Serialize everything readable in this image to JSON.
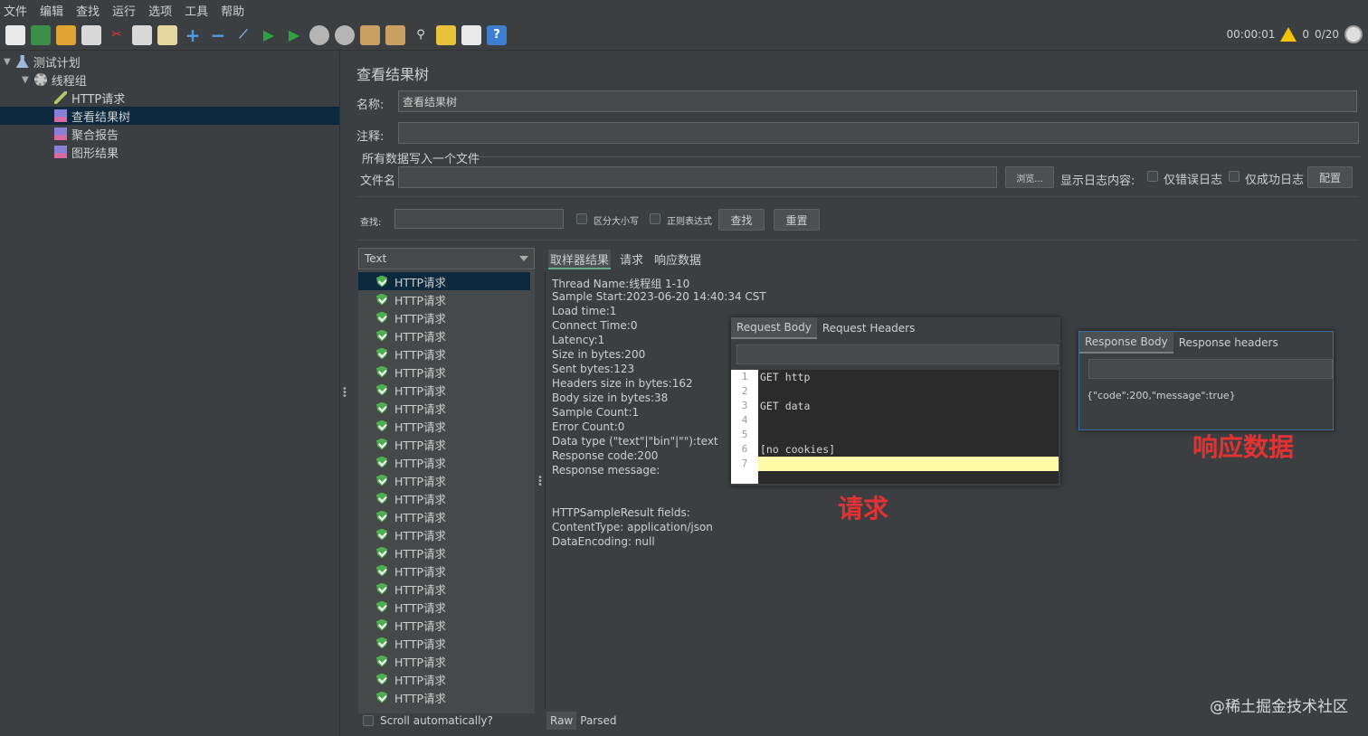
{
  "menu": [
    "文件",
    "编辑",
    "查找",
    "运行",
    "选项",
    "工具",
    "帮助"
  ],
  "toolbar": {
    "timer": "00:00:01",
    "warn_count": "0",
    "threads": "0/20",
    "icons": [
      "new-file-icon",
      "templates-icon",
      "open-icon",
      "save-icon",
      "cut-icon",
      "copy-icon",
      "paste-icon",
      "expand-icon",
      "collapse-icon",
      "toggle-icon",
      "start-icon",
      "start-no-pause-icon",
      "stop-icon",
      "shutdown-icon",
      "clear-icon",
      "clear-all-icon",
      "search-icon",
      "reset-search-icon",
      "function-helper-icon",
      "help-icon"
    ]
  },
  "tree": {
    "items": [
      {
        "label": "测试计划",
        "icon": "flask-icon",
        "level": 0
      },
      {
        "label": "线程组",
        "icon": "gear-icon",
        "level": 1
      },
      {
        "label": "HTTP请求",
        "icon": "pipette-icon",
        "level": 2
      },
      {
        "label": "查看结果树",
        "icon": "chart-icon",
        "level": 2,
        "selected": true
      },
      {
        "label": "聚合报告",
        "icon": "chart-icon",
        "level": 2
      },
      {
        "label": "图形结果",
        "icon": "chart-icon",
        "level": 2
      }
    ]
  },
  "panel": {
    "title": "查看结果树",
    "name_label": "名称:",
    "name_value": "查看结果树",
    "comment_label": "注释:",
    "write_all_label": "所有数据写入一个文件",
    "filename_label": "文件名",
    "browse_label": "浏览...",
    "log_content_label": "显示日志内容:",
    "errors_only_label": "仅错误日志",
    "success_only_label": "仅成功日志",
    "config_label": "配置",
    "search_label": "查找:",
    "case_label": "区分大小写",
    "regex_label": "正则表达式",
    "find_button": "查找",
    "reset_button": "重置"
  },
  "renderer": "Text",
  "results": {
    "item_label": "HTTP请求",
    "count": 24
  },
  "scroll_label": "Scroll automatically?",
  "detail_tabs": [
    "取样器结果",
    "请求",
    "响应数据"
  ],
  "sampler_info": [
    "Thread Name:线程组 1-10",
    "Sample Start:2023-06-20 14:40:34 CST",
    "Load time:1",
    "Connect Time:0",
    "Latency:1",
    "Size in bytes:200",
    "Sent bytes:123",
    "Headers size in bytes:162",
    "Body size in bytes:38",
    "Sample Count:1",
    "Error Count:0",
    "Data type (\"text\"|\"bin\"|\"\"):text",
    "Response code:200",
    "Response message:"
  ],
  "sampler_fields": [
    "HTTPSampleResult fields:",
    "ContentType: application/json",
    "DataEncoding: null"
  ],
  "request_overlay": {
    "tabs": [
      "Request Body",
      "Request Headers"
    ],
    "lines": [
      "GET http",
      "",
      "GET data",
      "",
      "",
      "[no cookies]",
      ""
    ],
    "line_numbers": [
      "1",
      "2",
      "3",
      "4",
      "5",
      "6",
      "7"
    ],
    "annotation": "请求"
  },
  "response_overlay": {
    "tabs": [
      "Response Body",
      "Response headers"
    ],
    "body": "{\"code\":200,\"message\":true}",
    "annotation": "响应数据"
  },
  "bottom_tabs": [
    "Raw",
    "Parsed"
  ],
  "watermark": "@稀土掘金技术社区"
}
